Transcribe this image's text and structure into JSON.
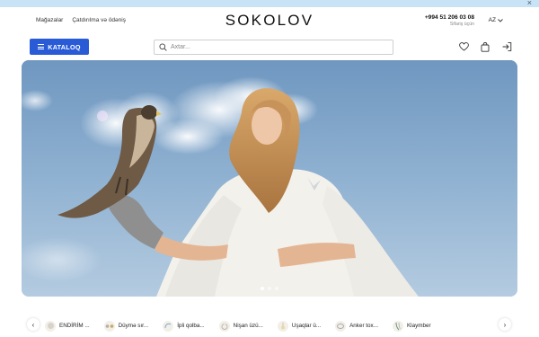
{
  "promo": {
    "close_glyph": "×"
  },
  "header": {
    "links": [
      "Mağazalar",
      "Çatdırılma və ödəniş"
    ],
    "logo": "SOKOLOV",
    "phone": "+994 51 206 03 08",
    "phone_caption": "Sifariş üçün",
    "language": "AZ"
  },
  "nav": {
    "catalog_label": "KATALOQ",
    "search_placeholder": "Axtar...",
    "icons": [
      "heart-icon",
      "cart-icon",
      "login-icon"
    ],
    "accent_color": "#2a5bd7"
  },
  "hero": {
    "slides_count": 3,
    "active_slide": 1
  },
  "categories": {
    "items": [
      {
        "label": "ENDİRİM ...",
        "icon": "sale-thumb"
      },
      {
        "label": "Düymə sır...",
        "icon": "stud-earring-thumb"
      },
      {
        "label": "İpli qolba...",
        "icon": "string-bracelet-thumb"
      },
      {
        "label": "Nişan üzü...",
        "icon": "engagement-ring-thumb"
      },
      {
        "label": "Uşaqlar ü...",
        "icon": "kids-jewelry-thumb"
      },
      {
        "label": "Anker tox...",
        "icon": "anchor-chain-thumb"
      },
      {
        "label": "Klaymber",
        "icon": "climber-earring-thumb"
      }
    ],
    "prev_glyph": "‹",
    "next_glyph": "›"
  }
}
